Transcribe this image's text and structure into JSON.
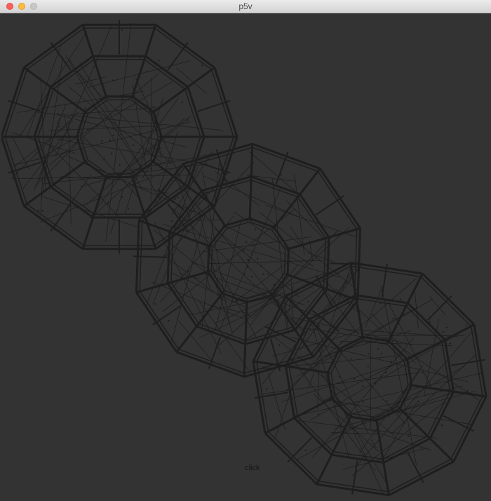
{
  "window": {
    "title": "p5v",
    "controls": [
      "close",
      "minimize",
      "maximize"
    ]
  },
  "canvas": {
    "background": "#333333",
    "stroke_color": "#1e1e1e",
    "shapes": [
      "polyhedron-wireframe",
      "polyhedron-wireframe",
      "polyhedron-wireframe"
    ],
    "hint_text": "click"
  }
}
